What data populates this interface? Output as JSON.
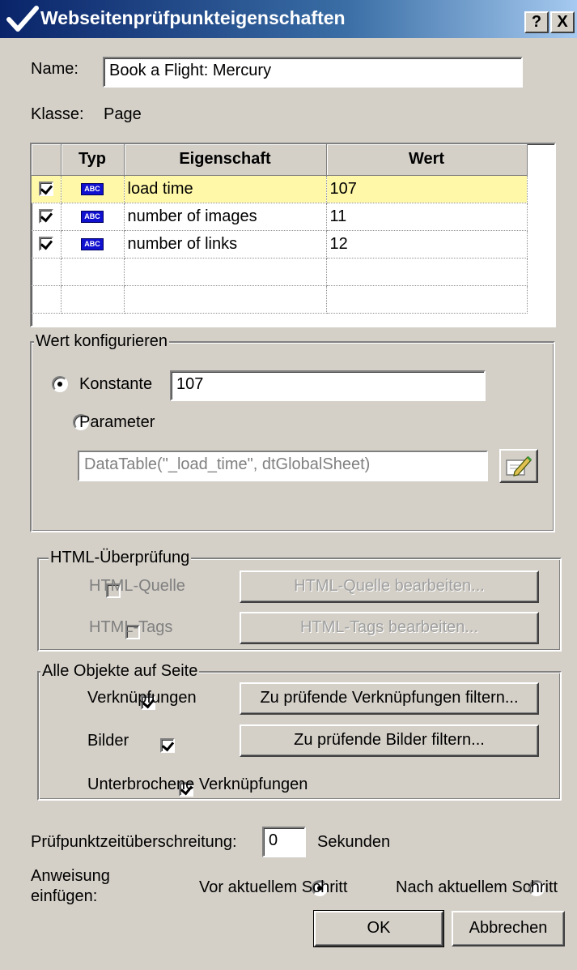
{
  "window": {
    "title": "Webseitenprüfpunkteigenschaften",
    "help_button": "?",
    "close_button": "X"
  },
  "name_label": "Name:",
  "name_value": "Book a Flight: Mercury",
  "class_label": "Klasse:",
  "class_value": "Page",
  "grid": {
    "headers": [
      "",
      "Typ",
      "Eigenschaft",
      "Wert"
    ],
    "rows": [
      {
        "checked": true,
        "type": "ABC",
        "property": "load time",
        "value": "107",
        "selected": true
      },
      {
        "checked": true,
        "type": "ABC",
        "property": "number of images",
        "value": "11",
        "selected": false
      },
      {
        "checked": true,
        "type": "ABC",
        "property": "number of links",
        "value": "12",
        "selected": false
      }
    ]
  },
  "configure": {
    "legend": "Wert konfigurieren",
    "constant_label": "Konstante",
    "constant_value": "107",
    "parameter_label": "Parameter",
    "parameter_value": "DataTable(\"_load_time\", dtGlobalSheet)",
    "selected": "Konstante"
  },
  "html_check": {
    "legend": "HTML-Überprüfung",
    "source_label": "HTML-Quelle",
    "source_button": "HTML-Quelle bearbeiten...",
    "tags_label": "HTML-Tags",
    "tags_button": "HTML-Tags bearbeiten..."
  },
  "all_objects": {
    "legend": "Alle Objekte auf Seite",
    "links_label": "Verknüpfungen",
    "links_button": "Zu prüfende Verknüpfungen filtern...",
    "images_label": "Bilder",
    "images_button": "Zu prüfende Bilder filtern...",
    "broken_label": "Unterbrochene Verknüpfungen"
  },
  "timeout": {
    "label": "Prüfpunktzeitüberschreitung:",
    "value": "0",
    "unit": "Sekunden"
  },
  "insert": {
    "label_line1": "Anweisung",
    "label_line2": "einfügen:",
    "before_label": "Vor aktuellem Schritt",
    "after_label": "Nach aktuellem Schritt",
    "selected": "Vor aktuellem Schritt"
  },
  "buttons": {
    "ok": "OK",
    "cancel": "Abbrechen"
  },
  "colors": {
    "titlebar_start": "#0a246a",
    "selected_row": "#fff8a8",
    "dialog_bg": "#d4d0c8"
  }
}
